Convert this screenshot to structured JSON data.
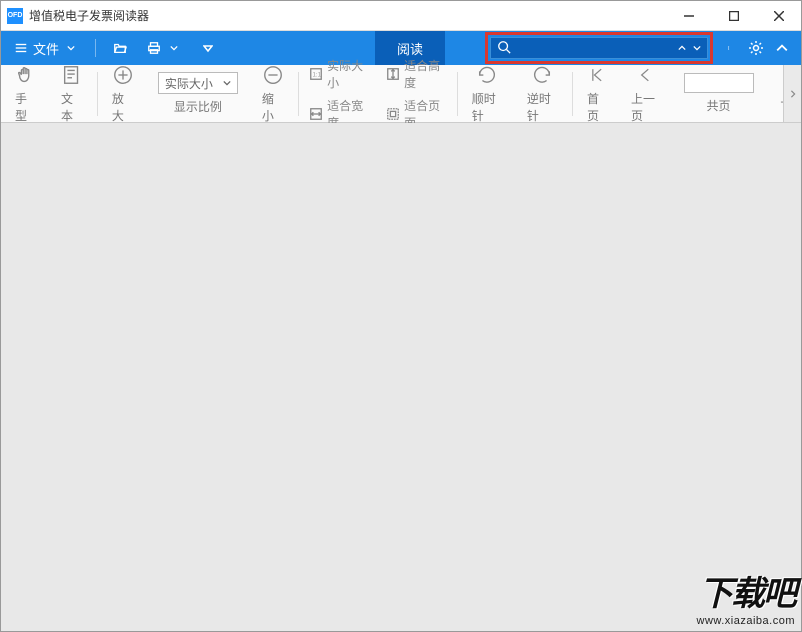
{
  "titlebar": {
    "app_icon_text": "OFD",
    "title": "增值税电子发票阅读器"
  },
  "menubar": {
    "file_label": "文件",
    "read_tab": "阅读",
    "search_value": ""
  },
  "toolbar": {
    "hand": "手型",
    "text": "文本",
    "zoom_in": "放大",
    "zoom_select": "实际大小",
    "zoom_ratio": "显示比例",
    "zoom_out": "缩小",
    "actual_size": "实际大小",
    "fit_width": "适合宽度",
    "fit_height": "适合高度",
    "fit_page": "适合页面",
    "rotate_cw": "顺时针",
    "rotate_ccw": "逆时针",
    "first_page": "首页",
    "prev_page": "上一页",
    "total_pages": "共页",
    "next_partial": "下"
  },
  "watermark": {
    "big": "下载吧",
    "url": "www.xiazaiba.com"
  }
}
